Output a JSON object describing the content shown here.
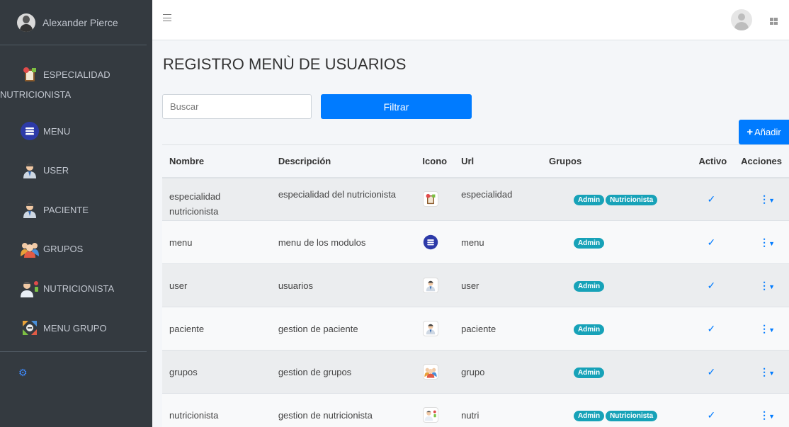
{
  "sidebar": {
    "user_name": "Alexander Pierce",
    "items": [
      {
        "label": "ESPECIALIDAD",
        "sub": "NUTRICIONISTA",
        "icon": "diet-board-icon"
      },
      {
        "label": "MENU",
        "icon": "menu-circle-icon"
      },
      {
        "label": "USER",
        "icon": "doctor-user-icon"
      },
      {
        "label": "PACIENTE",
        "icon": "doctor-patient-icon"
      },
      {
        "label": "GRUPOS",
        "icon": "group-people-icon"
      },
      {
        "label": "NUTRICIONISTA",
        "icon": "nutritionist-icon"
      },
      {
        "label": "MENU GRUPO",
        "icon": "menu-group-icon"
      }
    ],
    "footer_icon": "cogs-icon"
  },
  "topbar": {
    "menu_icon": "hamburger-icon",
    "apps_icon": "grid-icon"
  },
  "page": {
    "title": "REGISTRO MENÙ DE USUARIOS",
    "search_placeholder": "Buscar",
    "filter_label": "Filtrar",
    "add_label": "Añadir"
  },
  "table": {
    "headers": [
      "Nombre",
      "Descripción",
      "Icono",
      "Url",
      "Grupos",
      "Activo",
      "Acciones"
    ],
    "rows": [
      {
        "nombre": "especialidad nutricionista",
        "descripcion": "especialidad del nutricionista",
        "icono": "diet-board-icon",
        "url": "especialidad",
        "grupos": [
          "Admin",
          "Nutricionista"
        ],
        "activo": true
      },
      {
        "nombre": "menu",
        "descripcion": "menu de los modulos",
        "icono": "menu-circle-icon",
        "url": "menu",
        "grupos": [
          "Admin"
        ],
        "activo": true
      },
      {
        "nombre": "user",
        "descripcion": "usuarios",
        "icono": "doctor-user-icon",
        "url": "user",
        "grupos": [
          "Admin"
        ],
        "activo": true
      },
      {
        "nombre": "paciente",
        "descripcion": "gestion de paciente",
        "icono": "doctor-patient-icon",
        "url": "paciente",
        "grupos": [
          "Admin"
        ],
        "activo": true
      },
      {
        "nombre": "grupos",
        "descripcion": "gestion de grupos",
        "icono": "group-people-icon",
        "url": "grupo",
        "grupos": [
          "Admin"
        ],
        "activo": true
      },
      {
        "nombre": "nutricionista",
        "descripcion": "gestion de nutricionista",
        "icono": "nutritionist-icon",
        "url": "nutri",
        "grupos": [
          "Admin",
          "Nutricionista"
        ],
        "activo": true
      }
    ]
  },
  "colors": {
    "sidebar_bg": "#343a40",
    "primary": "#007bff",
    "badge": "#17a2b8"
  }
}
